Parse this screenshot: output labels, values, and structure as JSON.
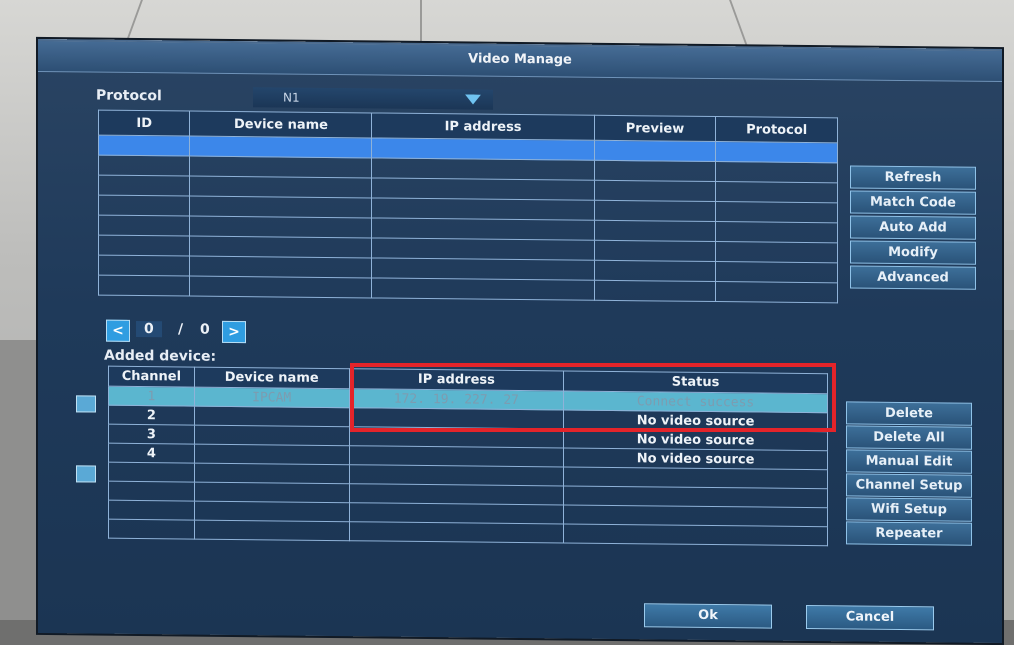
{
  "window": {
    "title": "Video Manage"
  },
  "protocol": {
    "label": "Protocol",
    "value": "N1"
  },
  "top_table": {
    "headers": [
      "ID",
      "Device name",
      "IP address",
      "Preview",
      "Protocol"
    ],
    "row_count": 8
  },
  "pagination": {
    "current": "0",
    "separator": "/",
    "total": "0"
  },
  "side_buttons": [
    "Refresh",
    "Match Code",
    "Auto Add",
    "Modify",
    "Advanced"
  ],
  "added": {
    "label": "Added device:"
  },
  "bottom_table": {
    "headers": [
      "Channel",
      "Device name",
      "IP address",
      "Status"
    ],
    "rows": [
      {
        "channel": "1",
        "device": "IPCAM",
        "ip": "172. 19. 227. 27",
        "status": "Connect success"
      },
      {
        "channel": "2",
        "device": "",
        "ip": "",
        "status": "No video source"
      },
      {
        "channel": "3",
        "device": "",
        "ip": "",
        "status": "No video source"
      },
      {
        "channel": "4",
        "device": "",
        "ip": "",
        "status": "No video source"
      },
      {
        "channel": "",
        "device": "",
        "ip": "",
        "status": ""
      },
      {
        "channel": "",
        "device": "",
        "ip": "",
        "status": ""
      },
      {
        "channel": "",
        "device": "",
        "ip": "",
        "status": ""
      },
      {
        "channel": "",
        "device": "",
        "ip": "",
        "status": ""
      }
    ]
  },
  "channel_buttons": [
    "Delete",
    "Delete All",
    "Manual Edit",
    "Channel Setup",
    "Wifi Setup",
    "Repeater"
  ],
  "dialog": {
    "ok": "Ok",
    "cancel": "Cancel"
  },
  "colors": {
    "highlight": "#e4242a",
    "selection": "#3c87ea"
  }
}
